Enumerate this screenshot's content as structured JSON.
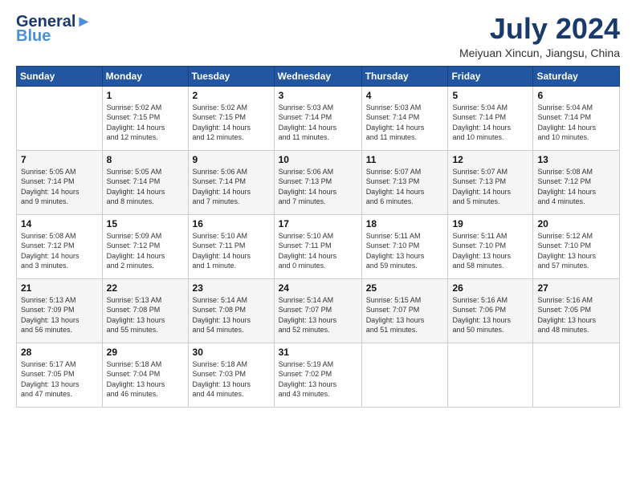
{
  "header": {
    "logo_line1": "General",
    "logo_line2": "Blue",
    "main_title": "July 2024",
    "subtitle": "Meiyuan Xincun, Jiangsu, China"
  },
  "calendar": {
    "days_of_week": [
      "Sunday",
      "Monday",
      "Tuesday",
      "Wednesday",
      "Thursday",
      "Friday",
      "Saturday"
    ],
    "weeks": [
      [
        {
          "day": "",
          "info": ""
        },
        {
          "day": "1",
          "info": "Sunrise: 5:02 AM\nSunset: 7:15 PM\nDaylight: 14 hours\nand 12 minutes."
        },
        {
          "day": "2",
          "info": "Sunrise: 5:02 AM\nSunset: 7:15 PM\nDaylight: 14 hours\nand 12 minutes."
        },
        {
          "day": "3",
          "info": "Sunrise: 5:03 AM\nSunset: 7:14 PM\nDaylight: 14 hours\nand 11 minutes."
        },
        {
          "day": "4",
          "info": "Sunrise: 5:03 AM\nSunset: 7:14 PM\nDaylight: 14 hours\nand 11 minutes."
        },
        {
          "day": "5",
          "info": "Sunrise: 5:04 AM\nSunset: 7:14 PM\nDaylight: 14 hours\nand 10 minutes."
        },
        {
          "day": "6",
          "info": "Sunrise: 5:04 AM\nSunset: 7:14 PM\nDaylight: 14 hours\nand 10 minutes."
        }
      ],
      [
        {
          "day": "7",
          "info": "Sunrise: 5:05 AM\nSunset: 7:14 PM\nDaylight: 14 hours\nand 9 minutes."
        },
        {
          "day": "8",
          "info": "Sunrise: 5:05 AM\nSunset: 7:14 PM\nDaylight: 14 hours\nand 8 minutes."
        },
        {
          "day": "9",
          "info": "Sunrise: 5:06 AM\nSunset: 7:14 PM\nDaylight: 14 hours\nand 7 minutes."
        },
        {
          "day": "10",
          "info": "Sunrise: 5:06 AM\nSunset: 7:13 PM\nDaylight: 14 hours\nand 7 minutes."
        },
        {
          "day": "11",
          "info": "Sunrise: 5:07 AM\nSunset: 7:13 PM\nDaylight: 14 hours\nand 6 minutes."
        },
        {
          "day": "12",
          "info": "Sunrise: 5:07 AM\nSunset: 7:13 PM\nDaylight: 14 hours\nand 5 minutes."
        },
        {
          "day": "13",
          "info": "Sunrise: 5:08 AM\nSunset: 7:12 PM\nDaylight: 14 hours\nand 4 minutes."
        }
      ],
      [
        {
          "day": "14",
          "info": "Sunrise: 5:08 AM\nSunset: 7:12 PM\nDaylight: 14 hours\nand 3 minutes."
        },
        {
          "day": "15",
          "info": "Sunrise: 5:09 AM\nSunset: 7:12 PM\nDaylight: 14 hours\nand 2 minutes."
        },
        {
          "day": "16",
          "info": "Sunrise: 5:10 AM\nSunset: 7:11 PM\nDaylight: 14 hours\nand 1 minute."
        },
        {
          "day": "17",
          "info": "Sunrise: 5:10 AM\nSunset: 7:11 PM\nDaylight: 14 hours\nand 0 minutes."
        },
        {
          "day": "18",
          "info": "Sunrise: 5:11 AM\nSunset: 7:10 PM\nDaylight: 13 hours\nand 59 minutes."
        },
        {
          "day": "19",
          "info": "Sunrise: 5:11 AM\nSunset: 7:10 PM\nDaylight: 13 hours\nand 58 minutes."
        },
        {
          "day": "20",
          "info": "Sunrise: 5:12 AM\nSunset: 7:10 PM\nDaylight: 13 hours\nand 57 minutes."
        }
      ],
      [
        {
          "day": "21",
          "info": "Sunrise: 5:13 AM\nSunset: 7:09 PM\nDaylight: 13 hours\nand 56 minutes."
        },
        {
          "day": "22",
          "info": "Sunrise: 5:13 AM\nSunset: 7:08 PM\nDaylight: 13 hours\nand 55 minutes."
        },
        {
          "day": "23",
          "info": "Sunrise: 5:14 AM\nSunset: 7:08 PM\nDaylight: 13 hours\nand 54 minutes."
        },
        {
          "day": "24",
          "info": "Sunrise: 5:14 AM\nSunset: 7:07 PM\nDaylight: 13 hours\nand 52 minutes."
        },
        {
          "day": "25",
          "info": "Sunrise: 5:15 AM\nSunset: 7:07 PM\nDaylight: 13 hours\nand 51 minutes."
        },
        {
          "day": "26",
          "info": "Sunrise: 5:16 AM\nSunset: 7:06 PM\nDaylight: 13 hours\nand 50 minutes."
        },
        {
          "day": "27",
          "info": "Sunrise: 5:16 AM\nSunset: 7:05 PM\nDaylight: 13 hours\nand 48 minutes."
        }
      ],
      [
        {
          "day": "28",
          "info": "Sunrise: 5:17 AM\nSunset: 7:05 PM\nDaylight: 13 hours\nand 47 minutes."
        },
        {
          "day": "29",
          "info": "Sunrise: 5:18 AM\nSunset: 7:04 PM\nDaylight: 13 hours\nand 46 minutes."
        },
        {
          "day": "30",
          "info": "Sunrise: 5:18 AM\nSunset: 7:03 PM\nDaylight: 13 hours\nand 44 minutes."
        },
        {
          "day": "31",
          "info": "Sunrise: 5:19 AM\nSunset: 7:02 PM\nDaylight: 13 hours\nand 43 minutes."
        },
        {
          "day": "",
          "info": ""
        },
        {
          "day": "",
          "info": ""
        },
        {
          "day": "",
          "info": ""
        }
      ]
    ]
  }
}
